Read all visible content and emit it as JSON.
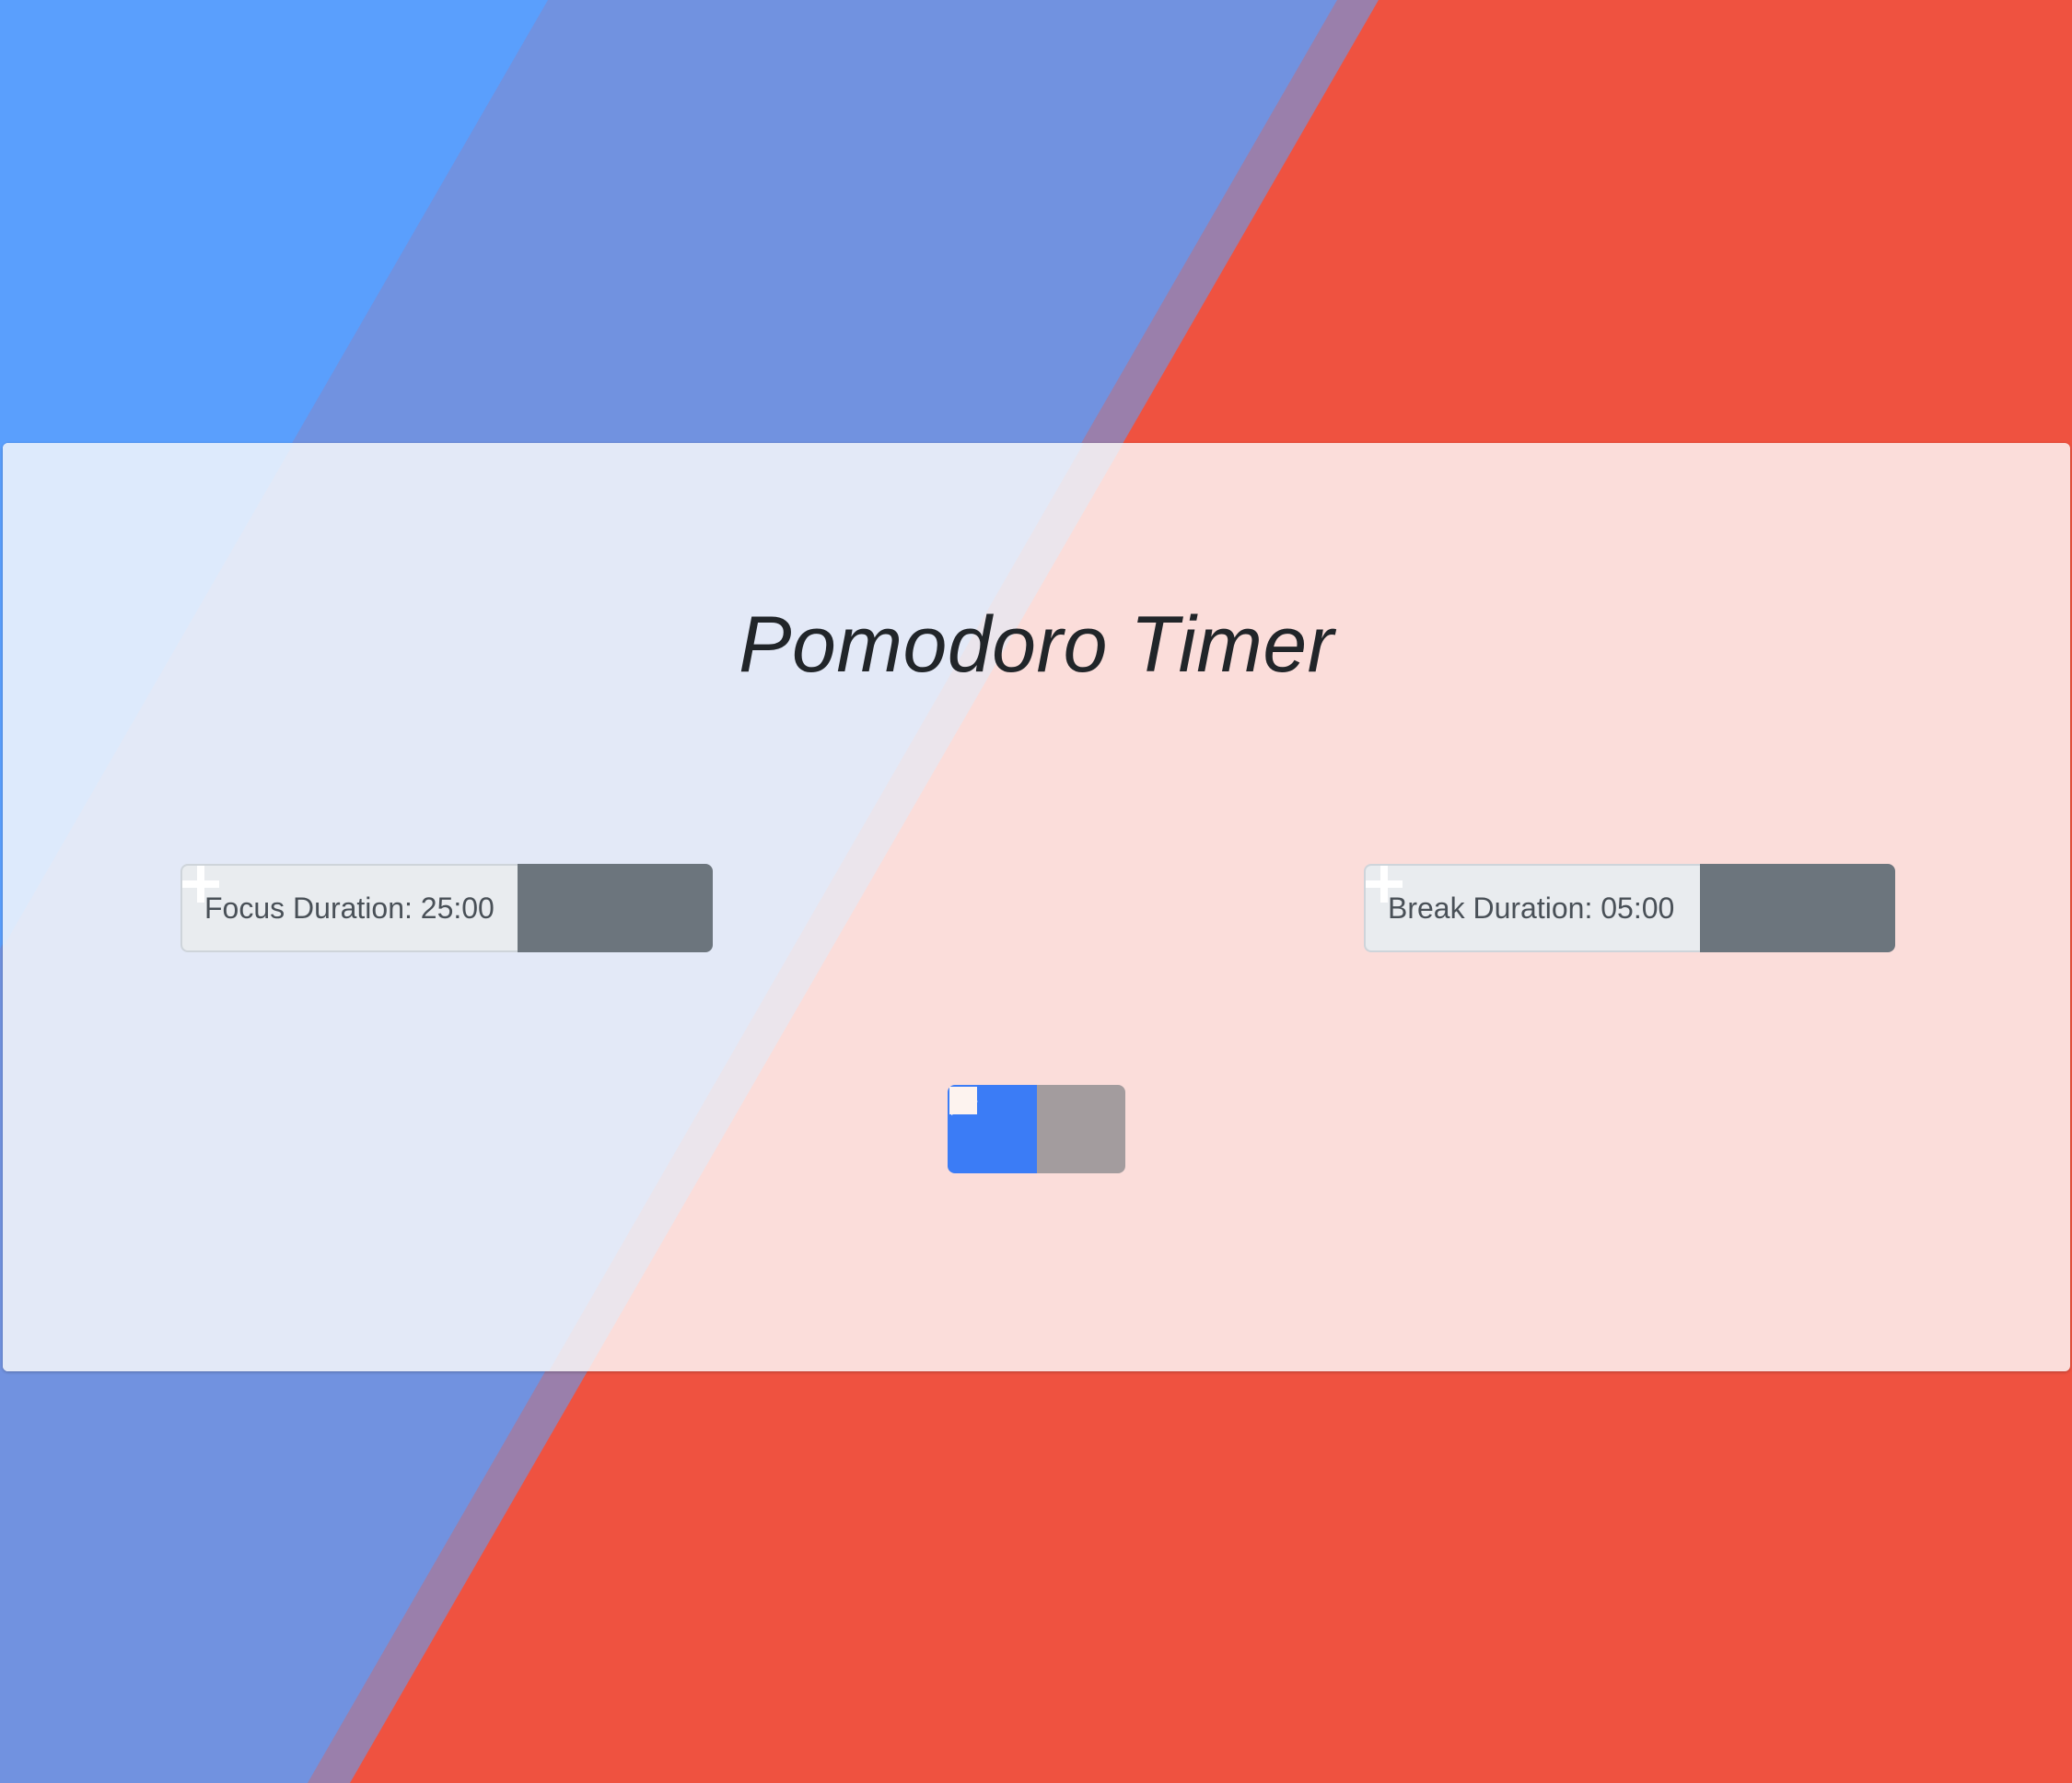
{
  "app": {
    "title": "Pomodoro Timer"
  },
  "focus": {
    "label": "Focus Duration: 25:00",
    "decrease_icon": "minus-icon",
    "increase_icon": "plus-icon"
  },
  "break": {
    "label": "Break Duration: 05:00",
    "decrease_icon": "minus-icon",
    "increase_icon": "plus-icon"
  },
  "controls": {
    "play_icon": "play-icon",
    "stop_icon": "stop-icon"
  },
  "colors": {
    "focus_blue": "#5a9ffd",
    "mid_blue": "#7192e0",
    "break_red": "#ef5240",
    "blend_purple": "#9a7fab",
    "play_button": "#3b7cf6",
    "stop_button": "#a39c9e",
    "step_button": "#6c757d"
  }
}
